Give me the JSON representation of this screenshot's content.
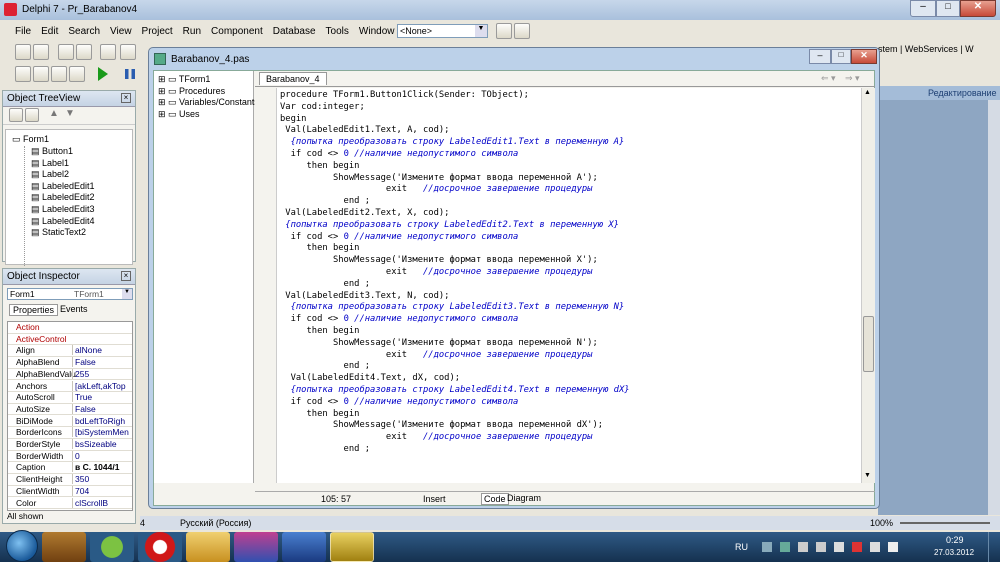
{
  "main_window": {
    "title": "Delphi 7 - Pr_Barabanov4",
    "menu": [
      "File",
      "Edit",
      "Search",
      "View",
      "Project",
      "Run",
      "Component",
      "Database",
      "Tools",
      "Window",
      "Help"
    ],
    "combo_value": "<None>"
  },
  "palette_tabs": [
    "stem",
    "WebServices",
    "W"
  ],
  "right_bg_label": "Редактирование",
  "treeview": {
    "title": "Object TreeView",
    "root": "Form1",
    "items": [
      "Button1",
      "Label1",
      "Label2",
      "LabeledEdit1",
      "LabeledEdit2",
      "LabeledEdit3",
      "LabeledEdit4",
      "StaticText2"
    ]
  },
  "inspector": {
    "title": "Object Inspector",
    "object": "Form1",
    "type": "TForm1",
    "tabs": [
      "Properties",
      "Events"
    ],
    "rows": [
      [
        "Action",
        ""
      ],
      [
        "ActiveControl",
        ""
      ],
      [
        "Align",
        "alNone"
      ],
      [
        "AlphaBlend",
        "False"
      ],
      [
        "AlphaBlendValu",
        "255"
      ],
      [
        "Anchors",
        "[akLeft,akTop"
      ],
      [
        "AutoScroll",
        "True"
      ],
      [
        "AutoSize",
        "False"
      ],
      [
        "BiDiMode",
        "bdLeftToRigh"
      ],
      [
        "BorderIcons",
        "[biSystemMen"
      ],
      [
        "BorderStyle",
        "bsSizeable"
      ],
      [
        "BorderWidth",
        "0"
      ],
      [
        "Caption",
        "в С. 1044/1"
      ],
      [
        "ClientHeight",
        "350"
      ],
      [
        "ClientWidth",
        "704"
      ],
      [
        "Color",
        "clScrollB"
      ]
    ],
    "status": "All shown"
  },
  "editor": {
    "title": "Barabanov_4.pas",
    "tab": "Barabanov_4",
    "explorer": [
      "TForm1",
      "Procedures",
      "Variables/Constants",
      "Uses"
    ],
    "status": {
      "pos": "105: 57",
      "mode": "Insert",
      "tabs": [
        "Code",
        "Diagram"
      ]
    },
    "lines": [
      [
        [
          "kw",
          "procedure TForm1.Button1Click(Sender: TObject);"
        ]
      ],
      [
        [
          "kw",
          "Var cod:integer;"
        ]
      ],
      [
        [
          "kw",
          "begin"
        ]
      ],
      [
        [
          "kw",
          " Val(LabeledEdit1.Text, A, cod);"
        ]
      ],
      [
        [
          "cm",
          "  {попытка преобразовать строку LabeledEdit1.Text в переменную A}"
        ]
      ],
      [
        [
          "kw",
          "  if cod <> "
        ],
        [
          "num",
          "0"
        ],
        [
          "cm",
          " //наличие недопустимого символа"
        ]
      ],
      [
        [
          "kw",
          "     then begin"
        ]
      ],
      [
        [
          "kw",
          "          ShowMessage('Измените формат ввода переменной A');"
        ]
      ],
      [
        [
          "kw",
          "                    exit   "
        ],
        [
          "cm",
          "//досрочное завершение процедуры"
        ]
      ],
      [
        [
          "kw",
          "            end ;"
        ]
      ],
      [
        [
          "kw",
          " Val(LabeledEdit2.Text, X, cod);"
        ]
      ],
      [
        [
          "cm",
          " {попытка преобразовать строку LabeledEdit2.Text в переменную X}"
        ]
      ],
      [
        [
          "kw",
          "  if cod <> "
        ],
        [
          "num",
          "0"
        ],
        [
          "cm",
          " //наличие недопустимого символа"
        ]
      ],
      [
        [
          "kw",
          "     then begin"
        ]
      ],
      [
        [
          "kw",
          "          ShowMessage('Измените формат ввода переменной X');"
        ]
      ],
      [
        [
          "kw",
          "                    exit   "
        ],
        [
          "cm",
          "//досрочное завершение процедуры"
        ]
      ],
      [
        [
          "kw",
          "            end ;"
        ]
      ],
      [
        [
          "kw",
          " Val(LabeledEdit3.Text, N, cod);"
        ]
      ],
      [
        [
          "cm",
          "  {попытка преобразовать строку LabeledEdit3.Text в переменную N}"
        ]
      ],
      [
        [
          "kw",
          "  if cod <> "
        ],
        [
          "num",
          "0"
        ],
        [
          "cm",
          " //наличие недопустимого символа"
        ]
      ],
      [
        [
          "kw",
          "     then begin"
        ]
      ],
      [
        [
          "kw",
          "          ShowMessage('Измените формат ввода переменной N');"
        ]
      ],
      [
        [
          "kw",
          "                    exit   "
        ],
        [
          "cm",
          "//досрочное завершение процедуры"
        ]
      ],
      [
        [
          "kw",
          "            end ;"
        ]
      ],
      [
        [
          "kw",
          "  Val(LabeledEdit4.Text, dX, cod);"
        ]
      ],
      [
        [
          "cm",
          "  {попытка преобразовать строку LabeledEdit4.Text в переменную dX}"
        ]
      ],
      [
        [
          "kw",
          "  if cod <> "
        ],
        [
          "num",
          "0"
        ],
        [
          "cm",
          " //наличие недопустимого символа"
        ]
      ],
      [
        [
          "kw",
          "     then begin"
        ]
      ],
      [
        [
          "kw",
          "          ShowMessage('Измените формат ввода переменной dX');"
        ]
      ],
      [
        [
          "kw",
          "                    exit   "
        ],
        [
          "cm",
          "//досрочное завершение процедуры"
        ]
      ],
      [
        [
          "kw",
          "            end ;"
        ]
      ]
    ]
  },
  "background_status": {
    "lang": "Русский (Россия)",
    "zoom": "100%",
    "left_num": "4"
  },
  "taskbar": {
    "lang": "RU",
    "time": "0:29",
    "date": "27.03.2012"
  }
}
